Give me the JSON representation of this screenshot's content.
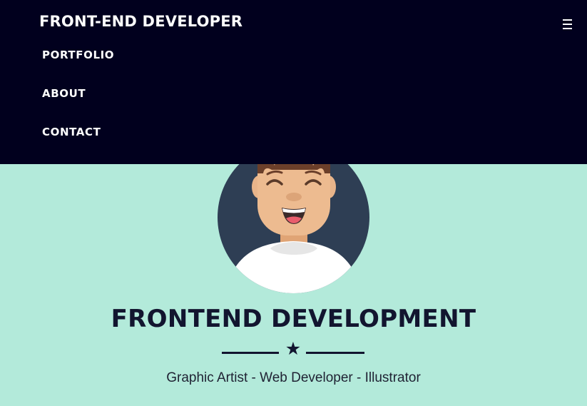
{
  "navbar": {
    "brand": "FRONT-END DEVELOPER",
    "menu_icon": "hamburger-menu-icon",
    "links": [
      {
        "label": "PORTFOLIO"
      },
      {
        "label": "ABOUT"
      },
      {
        "label": "CONTACT"
      }
    ],
    "background_color": "#01001e"
  },
  "hero": {
    "avatar": "smiling-developer-avatar",
    "title": "FRONTEND DEVELOPMENT",
    "divider_icon": "star-icon",
    "subtitle": "Graphic Artist - Web Developer - Illustrator",
    "background_color": "#b3eada",
    "text_color": "#12152f"
  }
}
